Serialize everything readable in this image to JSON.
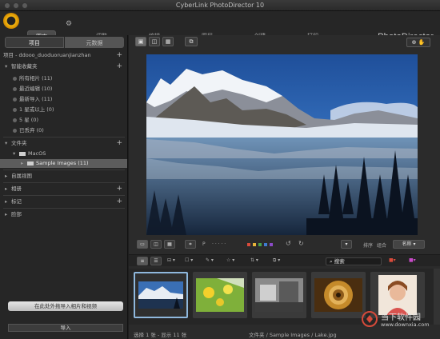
{
  "window": {
    "title": "CyberLink PhotoDirector 10"
  },
  "nav": {
    "tabs": [
      "图库",
      "调整",
      "编辑",
      "图层",
      "创建",
      "打印"
    ],
    "active": 0,
    "brand": "PhotoDirector"
  },
  "library": {
    "tabs": [
      "项目",
      "元数据"
    ],
    "project_label": "项目 - ddooo_duoduoruanjianzhan",
    "sections": {
      "smart": "智能收藏夹",
      "folders": "文件夹",
      "custom": "自属视图",
      "albums": "相册",
      "tags": "标记",
      "faces": "脸部"
    },
    "smart_items": [
      "所有相片 (11)",
      "最近编辑 (10)",
      "最新导入 (11)",
      "1 星或以上 (0)",
      "5 星 (0)",
      "已丢弃 (0)"
    ],
    "folder_root": "MacOS",
    "folder_item": "Sample Images (11)",
    "import_hint": "在此处外拖导入相片和视频",
    "import_button": "导入"
  },
  "toolbar": {
    "flag_label": "P",
    "rating_dots": "· · · · ·",
    "sort_label": "排序",
    "sort_select": "名称",
    "view_label": "组合",
    "search_placeholder": "搜索"
  },
  "colors": {
    "swatches": [
      "#d94b3b",
      "#e6b43a",
      "#4aa14a",
      "#3e7bd1",
      "#8c4bc9"
    ]
  },
  "filmstrip": {
    "count": 5,
    "selected": 0
  },
  "status": {
    "selection": "选择 1 张 - 显示 11 张",
    "path": "文件夹 / Sample Images / Lake.jpg"
  },
  "watermark": {
    "text": "当下软件园",
    "url": "www.downxia.com"
  }
}
